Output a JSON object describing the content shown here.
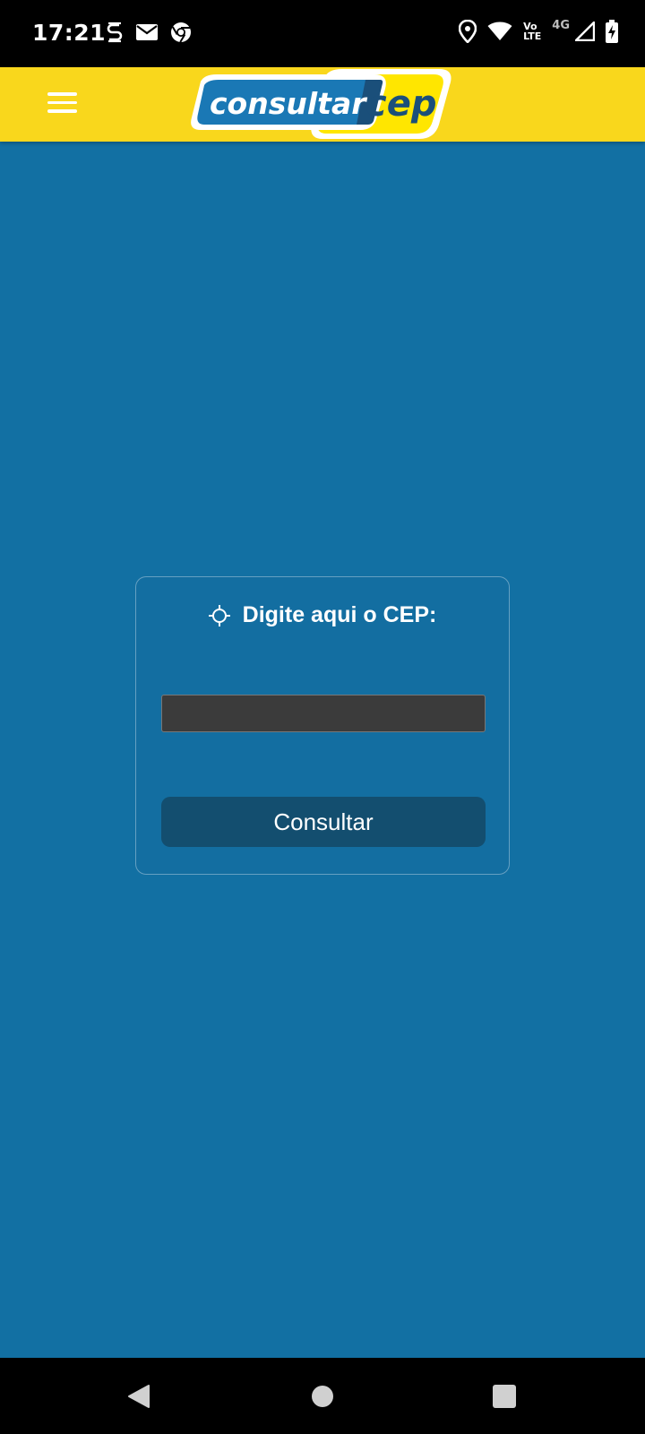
{
  "status_bar": {
    "time": "17:21",
    "left_icons": [
      "s-notification-icon",
      "mail-icon",
      "chrome-icon"
    ],
    "right_icons": [
      "location-icon",
      "wifi-icon",
      "volte-icon",
      "signal-icon",
      "battery-charging-icon"
    ],
    "volte_top": "Vo",
    "volte_bottom": "LTE",
    "network_type": "4G"
  },
  "header": {
    "background_color": "#f9d71c",
    "menu_icon": "hamburger-menu-icon",
    "logo": {
      "part1": "consultar",
      "part2": "cep"
    }
  },
  "main": {
    "background_color": "#1270a3",
    "card": {
      "title_icon": "crosshair-icon",
      "title": "Digite aqui o CEP:",
      "input_value": "",
      "input_placeholder": "",
      "button_label": "Consultar"
    }
  },
  "nav_bar": {
    "buttons": [
      "back-icon",
      "home-icon",
      "recents-icon"
    ]
  }
}
